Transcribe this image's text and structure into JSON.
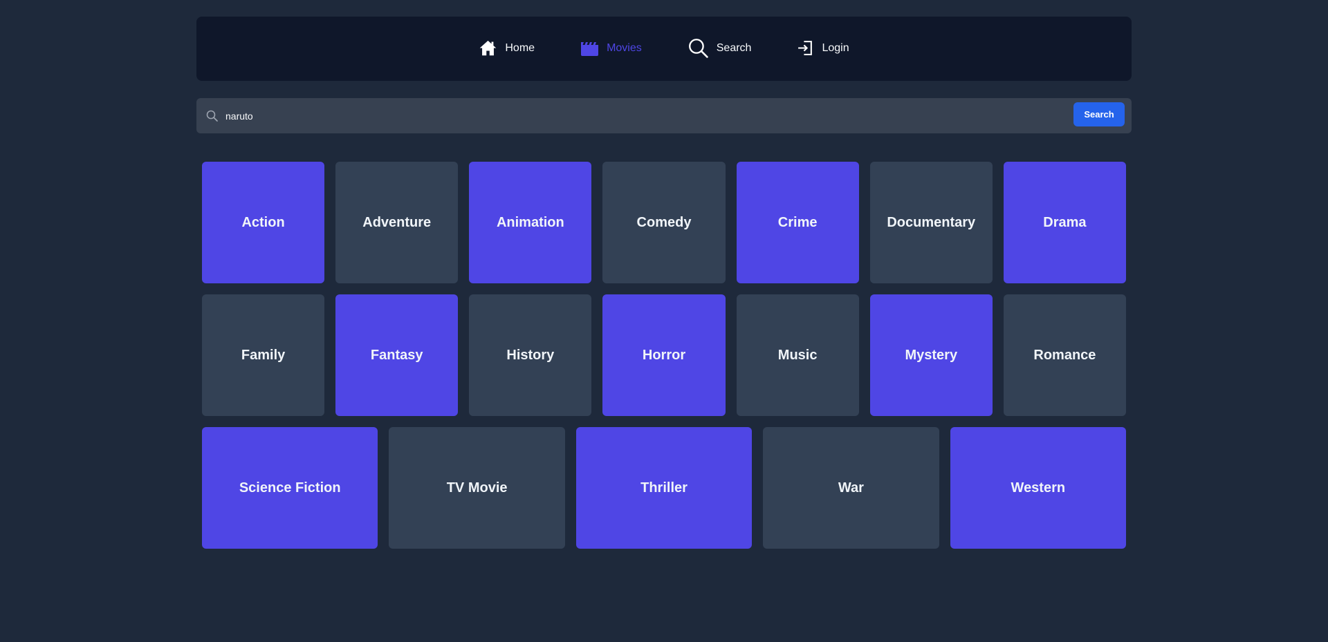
{
  "nav": {
    "items": [
      {
        "label": "Home",
        "icon": "home-icon",
        "active": false
      },
      {
        "label": "Movies",
        "icon": "clapperboard-icon",
        "active": true
      },
      {
        "label": "Search",
        "icon": "search-icon",
        "active": false
      },
      {
        "label": "Login",
        "icon": "login-icon",
        "active": false
      }
    ]
  },
  "search": {
    "value": "naruto",
    "placeholder": "",
    "button_label": "Search"
  },
  "colors": {
    "accent": "#4f46e5",
    "tile_alt": "#334155",
    "button": "#2563eb",
    "page_bg": "#1e293b",
    "nav_bg": "#0f172a"
  },
  "genres": {
    "row1": [
      "Action",
      "Adventure",
      "Animation",
      "Comedy",
      "Crime",
      "Documentary",
      "Drama"
    ],
    "row2": [
      "Family",
      "Fantasy",
      "History",
      "Horror",
      "Music",
      "Mystery",
      "Romance"
    ],
    "row3": [
      "Science Fiction",
      "TV Movie",
      "Thriller",
      "War",
      "Western"
    ]
  }
}
